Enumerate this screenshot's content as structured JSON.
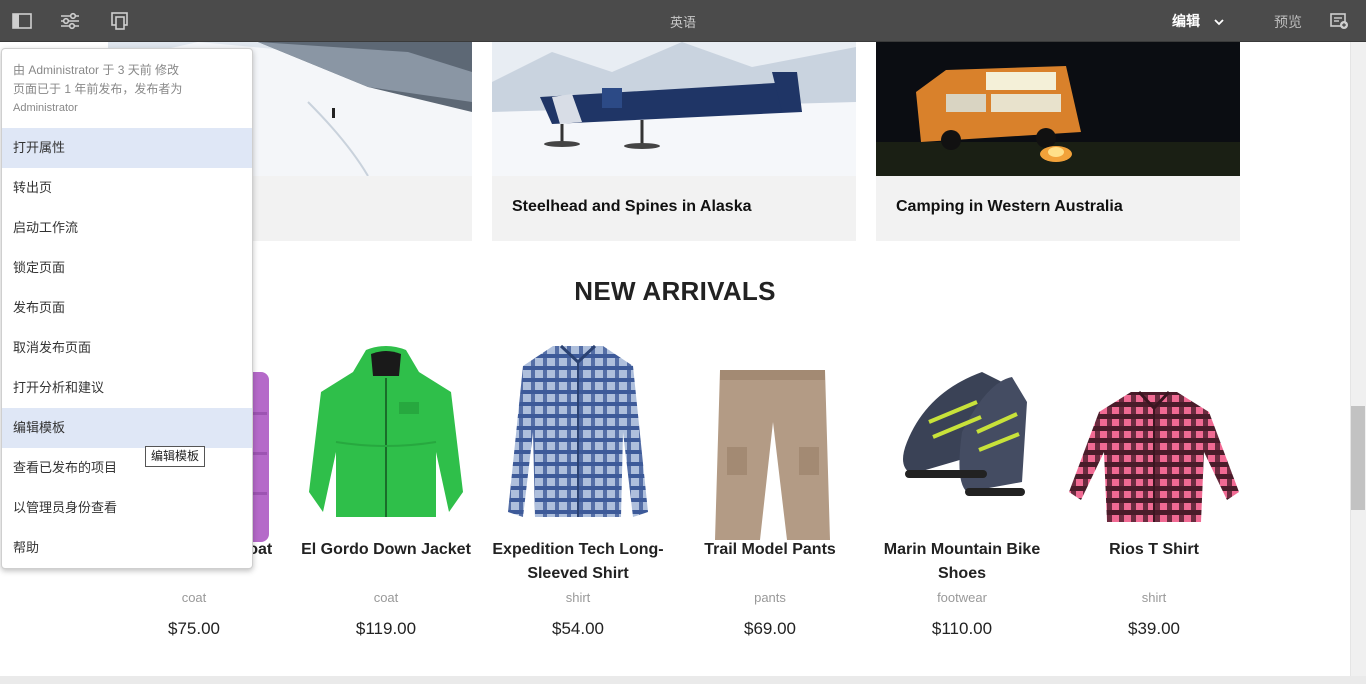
{
  "topbar": {
    "title": "英语",
    "mode": "编辑",
    "preview": "预览",
    "icons": [
      "side-panel-icon",
      "page-properties-icon",
      "emulator-icon",
      "annotations-icon",
      "chevron-down-icon"
    ]
  },
  "stories": [
    {
      "caption": ""
    },
    {
      "caption": "Steelhead and Spines in Alaska"
    },
    {
      "caption": "Camping in Western Australia"
    }
  ],
  "section": {
    "title": "NEW ARRIVALS"
  },
  "products": [
    {
      "name": "Sleek Insulated Coat",
      "category": "coat",
      "price": "$75.00"
    },
    {
      "name": "El Gordo Down Jacket",
      "category": "coat",
      "price": "$119.00"
    },
    {
      "name": "Expedition Tech Long-Sleeved Shirt",
      "category": "shirt",
      "price": "$54.00"
    },
    {
      "name": "Trail Model Pants",
      "category": "pants",
      "price": "$69.00"
    },
    {
      "name": "Marin Mountain Bike Shoes",
      "category": "footwear",
      "price": "$110.00"
    },
    {
      "name": "Rios T Shirt",
      "category": "shirt",
      "price": "$39.00"
    }
  ],
  "menu": {
    "info_line1": "由 Administrator 于 3 天前 修改",
    "info_line2": "页面已于 1 年前发布，发布者为",
    "info_line3": "Administrator",
    "items": [
      {
        "label": "打开属性"
      },
      {
        "label": "转出页"
      },
      {
        "label": "启动工作流"
      },
      {
        "label": "锁定页面"
      },
      {
        "label": "发布页面"
      },
      {
        "label": "取消发布页面"
      },
      {
        "label": "打开分析和建议"
      },
      {
        "label": "编辑模板"
      },
      {
        "label": "查看已发布的项目"
      },
      {
        "label": "以管理员身份查看"
      },
      {
        "label": "帮助"
      }
    ],
    "tooltip": "编辑模板"
  },
  "colors": {
    "topbar": "#4b4b4b",
    "menu_highlight": "#dfe7f6",
    "card_bg": "#f2f2f2"
  }
}
